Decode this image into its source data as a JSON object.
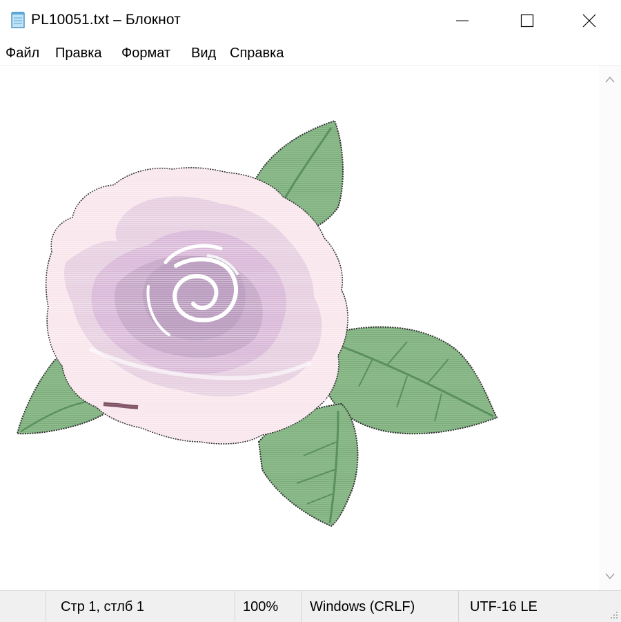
{
  "window": {
    "title": "PL10051.txt – Блокнот",
    "controls": [
      "minimize-icon",
      "maximize-icon",
      "close-icon"
    ]
  },
  "menu": {
    "items": [
      {
        "label": "Файл"
      },
      {
        "label": "Правка"
      },
      {
        "label": "Формат"
      },
      {
        "label": "Вид"
      },
      {
        "label": "Справка"
      }
    ]
  },
  "editor": {
    "content": "ascii-art-rose",
    "colors": {
      "petal_light": "#f8e6ec",
      "petal_mid": "#d9b8d8",
      "petal_dark": "#b89abd",
      "leaf": "#8dbb8c",
      "leaf_dark": "#5a8f5e",
      "outline": "#2b2b2b"
    }
  },
  "status": {
    "position": "Стр 1, стлб 1",
    "zoom": "100%",
    "line_ending": "Windows (CRLF)",
    "encoding": "UTF-16 LE"
  }
}
